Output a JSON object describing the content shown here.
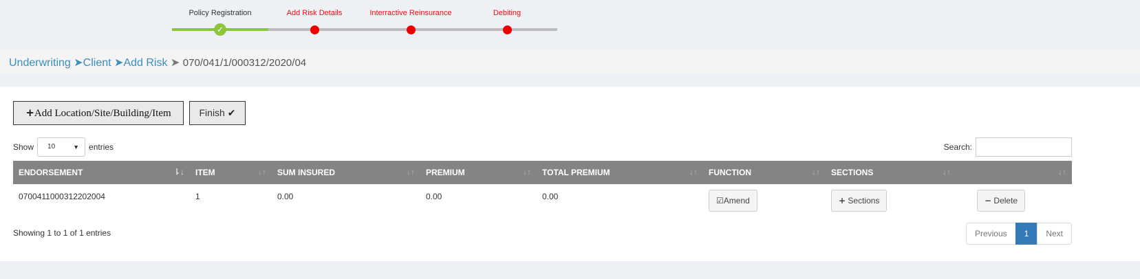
{
  "wizard": {
    "progress": 0.25,
    "steps": [
      {
        "label": "Policy Registration",
        "state": "done",
        "color": "#333333"
      },
      {
        "label": "Add Risk Details",
        "state": "pending",
        "color": "#ee1111"
      },
      {
        "label": "Interractive Reinsurance",
        "state": "pending",
        "color": "#ee1111"
      },
      {
        "label": "Debiting",
        "state": "pending",
        "color": "#ee1111"
      }
    ],
    "done_icon": "check-icon"
  },
  "breadcrumb": {
    "items": [
      "Underwriting",
      "Client",
      "Add Risk"
    ],
    "current": "070/041/1/000312/2020/04"
  },
  "toolbar": {
    "add_label": "Add Location/Site/Building/Item",
    "finish_label": "Finish"
  },
  "table_controls": {
    "show_label": "Show",
    "entries_value": "10",
    "entries_label": "entries",
    "search_label": "Search:",
    "search_value": ""
  },
  "table": {
    "columns": [
      "ENDORSEMENT",
      "ITEM",
      "SUM INSURED",
      "PREMIUM",
      "TOTAL PREMIUM",
      "FUNCTION",
      "SECTIONS",
      ""
    ],
    "rows": [
      {
        "endorsement": "0700411000312202004",
        "item": "1",
        "sum_insured": "0.00",
        "premium": "0.00",
        "total_premium": "0.00",
        "amend_label": "Amend",
        "sections_label": "Sections",
        "delete_label": "Delete"
      }
    ]
  },
  "footer": {
    "info": "Showing 1 to 1 of 1 entries",
    "previous": "Previous",
    "page": "1",
    "next": "Next"
  },
  "colors": {
    "accent": "#3c8dbc",
    "success": "#8cc63f",
    "pending": "#ee1111",
    "header": "#848484",
    "page_active": "#337ab7"
  }
}
